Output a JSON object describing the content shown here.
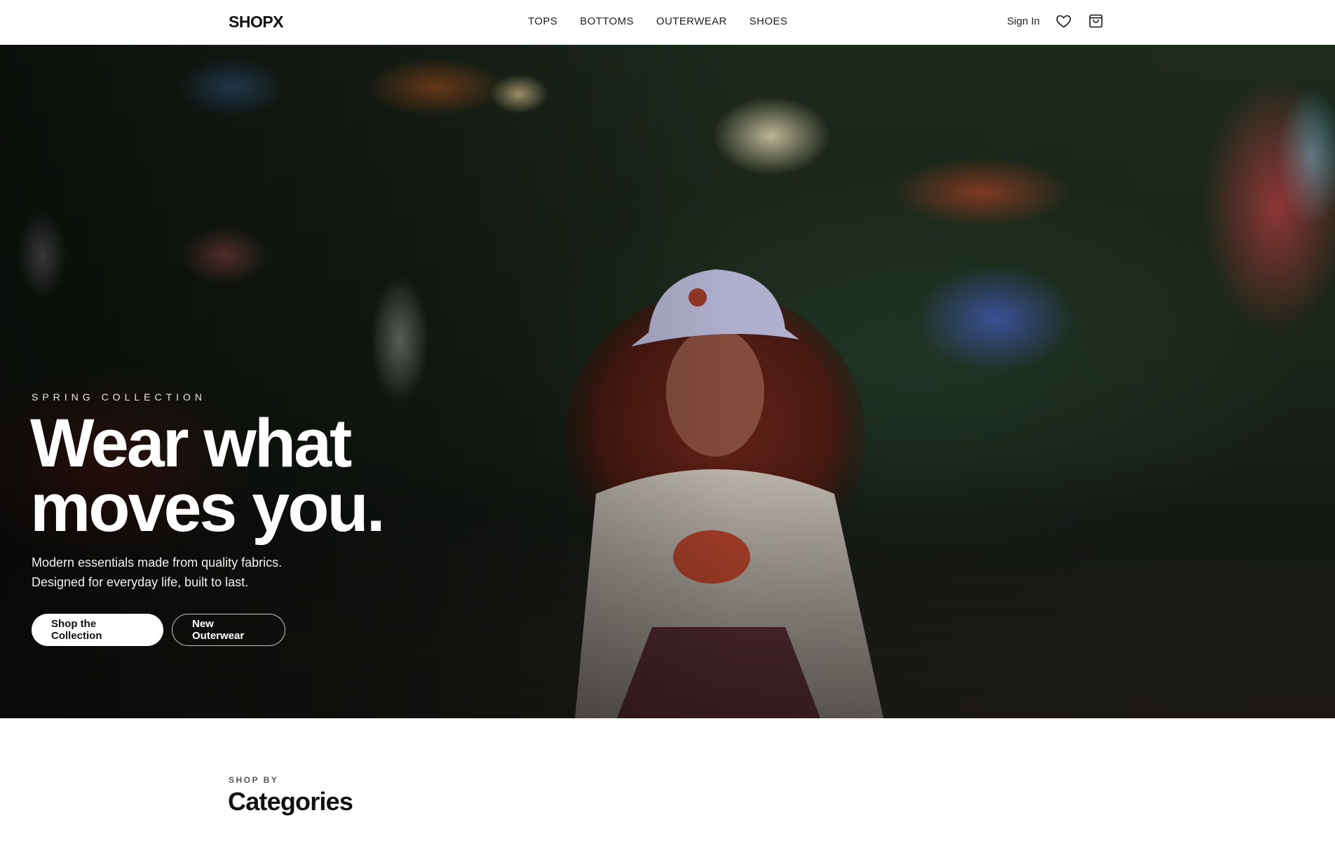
{
  "header": {
    "logo": "SHOPX",
    "nav": [
      "TOPS",
      "BOTTOMS",
      "OUTERWEAR",
      "SHOES"
    ],
    "sign_in": "Sign In",
    "icons": [
      "heart-icon",
      "shopping-bag-icon"
    ]
  },
  "hero": {
    "eyebrow": "SPRING COLLECTION",
    "headline_line1": "Wear what",
    "headline_line2": "moves you.",
    "subtext_line1": "Modern essentials made from quality fabrics.",
    "subtext_line2": "Designed for everyday life, built to last.",
    "primary_button": "Shop the Collection",
    "secondary_button": "New Outerwear"
  },
  "categories": {
    "eyebrow": "SHOP BY",
    "title": "Categories"
  },
  "colors": {
    "background": "#ffffff",
    "text": "#111111",
    "hero_overlay": "#000000",
    "button_primary_bg": "#ffffff"
  }
}
